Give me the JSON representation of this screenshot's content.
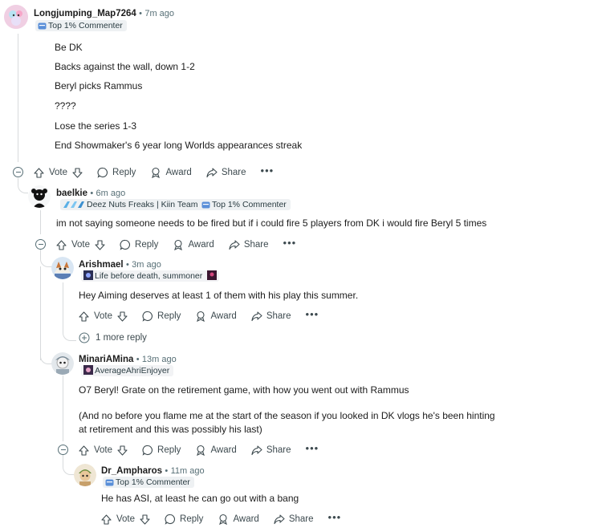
{
  "comments": [
    {
      "username": "Longjumping_Map7264",
      "time": "7m ago",
      "flair": "Top 1% Commenter",
      "lines": [
        "Be DK",
        "Backs against the wall, down 1-2",
        "Beryl picks Rammus",
        "????",
        "Lose the series 1-3",
        "End Showmaker's 6 year long Worlds appearances streak"
      ]
    },
    {
      "username": "baelkie",
      "time": "6m ago",
      "flair": "Deez Nuts Freaks | Kiin Team",
      "flair2": "Top 1% Commenter",
      "text": "im not saying someone needs to be fired but if i could fire 5 players from DK i would fire Beryl 5 times"
    },
    {
      "username": "Arishmael",
      "time": "3m ago",
      "flair": "Life before death, summoner",
      "text": "Hey Aiming deserves at least 1 of them with his play this summer."
    },
    {
      "username": "MinariAMina",
      "time": "13m ago",
      "flair": "AverageAhriEnjoyer",
      "text1": "O7 Beryl! Grate on the retirement game, with how you went out with Rammus",
      "text2a": "(And no before you flame me at the start of the season if you looked in DK vlogs he's been hinting",
      "text2b": "at retirement and this was possibly his last)"
    },
    {
      "username": "Dr_Ampharos",
      "time": "11m ago",
      "flair": "Top 1% Commenter",
      "text": "He has ASI, at least he can go out with a bang"
    }
  ],
  "actions": {
    "vote": "Vote",
    "reply": "Reply",
    "award": "Award",
    "share": "Share",
    "more": "•••"
  },
  "more_replies": "1 more reply",
  "separator": "•"
}
